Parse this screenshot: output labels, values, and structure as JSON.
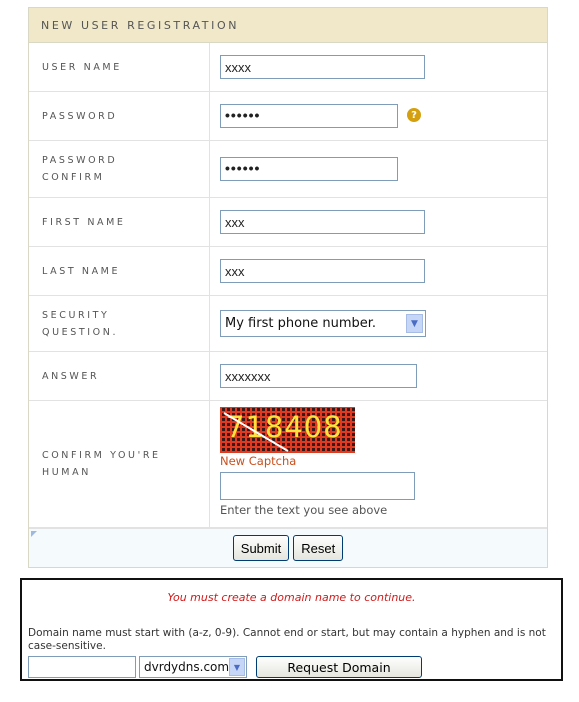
{
  "registration": {
    "title": "NEW USER REGISTRATION",
    "fields": {
      "username": {
        "label": "USER NAME",
        "value": "xxxx"
      },
      "password": {
        "label": "PASSWORD",
        "value": "••••••"
      },
      "password_confirm": {
        "label": "PASSWORD CONFIRM",
        "value": "••••••"
      },
      "first_name": {
        "label": "FIRST NAME",
        "value": "xxx"
      },
      "last_name": {
        "label": "LAST NAME",
        "value": "xxx"
      },
      "security_question": {
        "label": "SECURITY QUESTION.",
        "selected": "My first phone number."
      },
      "answer": {
        "label": "ANSWER",
        "value": "xxxxxxx"
      },
      "captcha": {
        "label": "CONFIRM YOU'RE HUMAN",
        "image_text": "718408",
        "new_captcha_link": "New Captcha",
        "hint": "Enter the text you see above",
        "input_value": ""
      }
    },
    "buttons": {
      "submit": "Submit",
      "reset": "Reset"
    },
    "icons": {
      "help": "help-icon"
    },
    "colors": {
      "header_bg": "#f0e8c8",
      "help_icon": "#d4a010",
      "captcha_link": "#c8501e"
    }
  },
  "domain_request": {
    "error": "You must create a domain name to continue.",
    "description": "Domain name must start with (a-z, 0-9). Cannot end or start, but may contain a hyphen and is not case-sensitive.",
    "input_value": "",
    "suffix_selected": "dvrdydns.com",
    "request_button": "Request Domain",
    "colors": {
      "error": "#d21a1a"
    }
  }
}
